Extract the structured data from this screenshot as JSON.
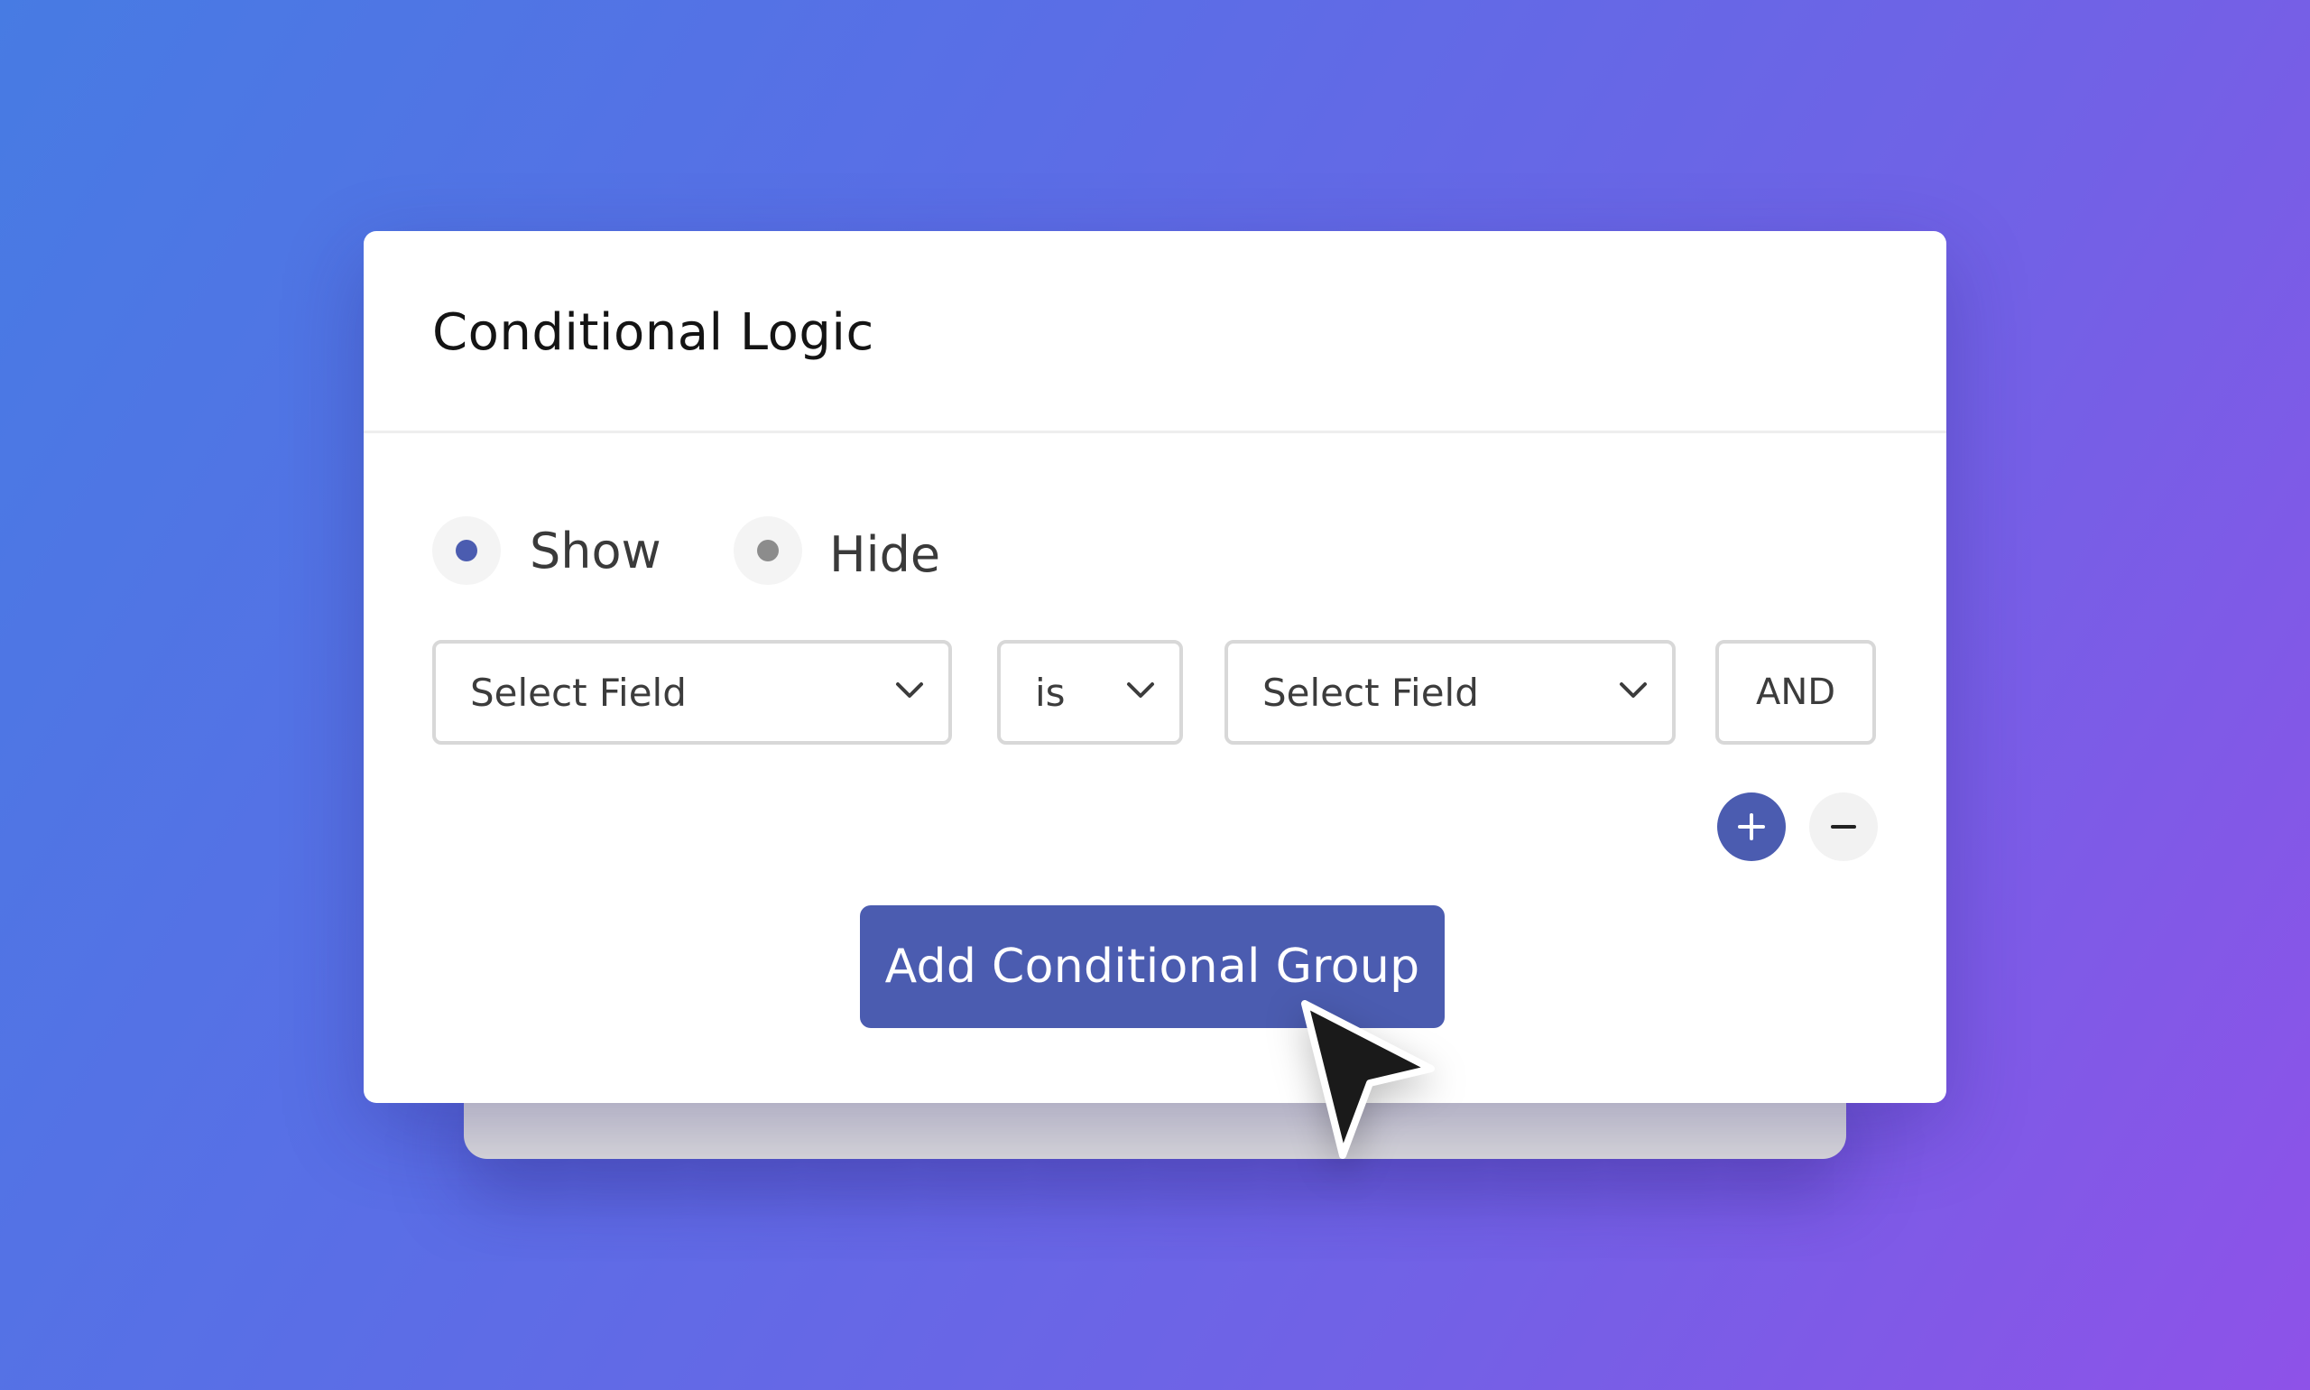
{
  "panel": {
    "title": "Conditional Logic"
  },
  "visibility": {
    "options": [
      {
        "label": "Show",
        "selected": true,
        "dot_color": "#4b5cb0"
      },
      {
        "label": "Hide",
        "selected": false,
        "dot_color": "#8c8c8c"
      }
    ]
  },
  "condition": {
    "field_select": "Select Field",
    "operator_select": "is",
    "value_select": "Select Field",
    "logic": "AND"
  },
  "actions": {
    "add_rule_icon": "plus-icon",
    "remove_rule_icon": "minus-icon",
    "add_group_label": "Add Conditional Group"
  },
  "colors": {
    "accent": "#4b5cb0",
    "border": "#d8d8d8",
    "text": "#3c3c3c"
  }
}
